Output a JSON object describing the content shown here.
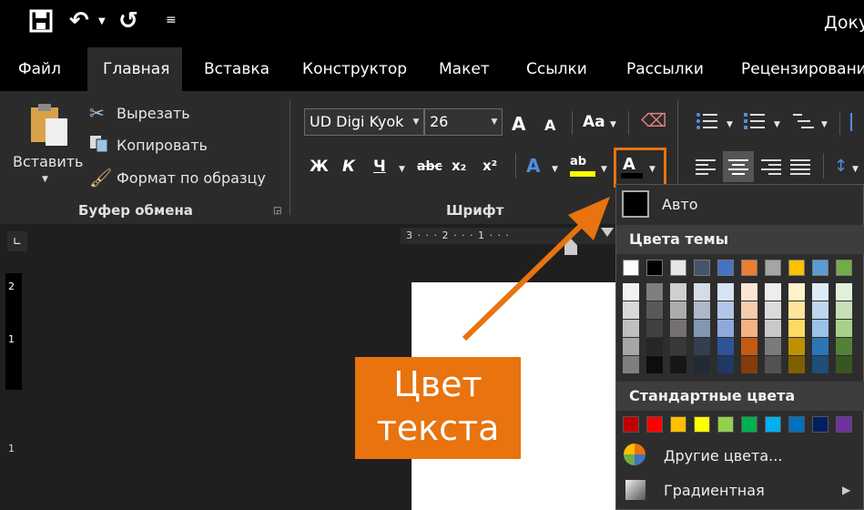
{
  "qat": {
    "save": "💾",
    "undo": "↶",
    "redo": "↺",
    "customize": "⇟",
    "doc_title": "Доку"
  },
  "menu": {
    "tabs": [
      "Файл",
      "Главная",
      "Вставка",
      "Конструктор",
      "Макет",
      "Ссылки",
      "Рассылки",
      "Рецензирование"
    ],
    "active": "Главная"
  },
  "clipboard": {
    "paste": "Вставить",
    "cut": "Вырезать",
    "copy": "Копировать",
    "format_painter": "Формат по образцу",
    "group_label": "Буфер обмена"
  },
  "font": {
    "name": "UD Digi Kyok",
    "size": "26",
    "grow": "A",
    "shrink": "A",
    "case": "Aa",
    "bold": "Ж",
    "italic": "К",
    "underline": "Ч",
    "strike": "abc",
    "subscript": "x₂",
    "superscript": "x²",
    "text_effects": "A",
    "highlight": "ab",
    "font_color": "A",
    "group_label": "Шрифт"
  },
  "ruler": {
    "marks": "3 · · · 2 · · · 1 · · ·",
    "vmarks": [
      "2",
      "1",
      "1"
    ]
  },
  "color_menu": {
    "auto": "Авто",
    "theme_header": "Цвета темы",
    "theme_top": [
      "#ffffff",
      "#000000",
      "#e7e6e6",
      "#44546a",
      "#4472c4",
      "#ed7d31",
      "#a5a5a5",
      "#ffc000",
      "#5b9bd5",
      "#70ad47"
    ],
    "theme_shades": [
      [
        "#f2f2f2",
        "#d9d9d9",
        "#bfbfbf",
        "#a6a6a6",
        "#7f7f7f"
      ],
      [
        "#7f7f7f",
        "#595959",
        "#404040",
        "#262626",
        "#0d0d0d"
      ],
      [
        "#d0cece",
        "#aeabab",
        "#757171",
        "#3a3838",
        "#171616"
      ],
      [
        "#d6dce4",
        "#adb9ca",
        "#8497b0",
        "#333f4f",
        "#222a35"
      ],
      [
        "#d9e2f3",
        "#b4c6e7",
        "#8eaadb",
        "#2f5496",
        "#1f3864"
      ],
      [
        "#fbe5d5",
        "#f7cbac",
        "#f4b183",
        "#c55a11",
        "#843c0b"
      ],
      [
        "#ededed",
        "#dbdbdb",
        "#c9c9c9",
        "#7b7b7b",
        "#525252"
      ],
      [
        "#fff2cc",
        "#fee599",
        "#ffd965",
        "#bf9000",
        "#7f6000"
      ],
      [
        "#deebf6",
        "#bdd7ee",
        "#9cc3e5",
        "#2e75b5",
        "#1e4e79"
      ],
      [
        "#e2efd9",
        "#c5e0b3",
        "#a8d08d",
        "#538135",
        "#375623"
      ]
    ],
    "standard_header": "Стандартные цвета",
    "standard": [
      "#c00000",
      "#ff0000",
      "#ffc000",
      "#ffff00",
      "#92d050",
      "#00b050",
      "#00b0f0",
      "#0070c0",
      "#002060",
      "#7030a0"
    ],
    "more_colors": "Другие цвета...",
    "gradient": "Градиентная"
  },
  "callout": {
    "line1": "Цвет",
    "line2": "текста"
  },
  "colors": {
    "accent": "#e8730f"
  }
}
